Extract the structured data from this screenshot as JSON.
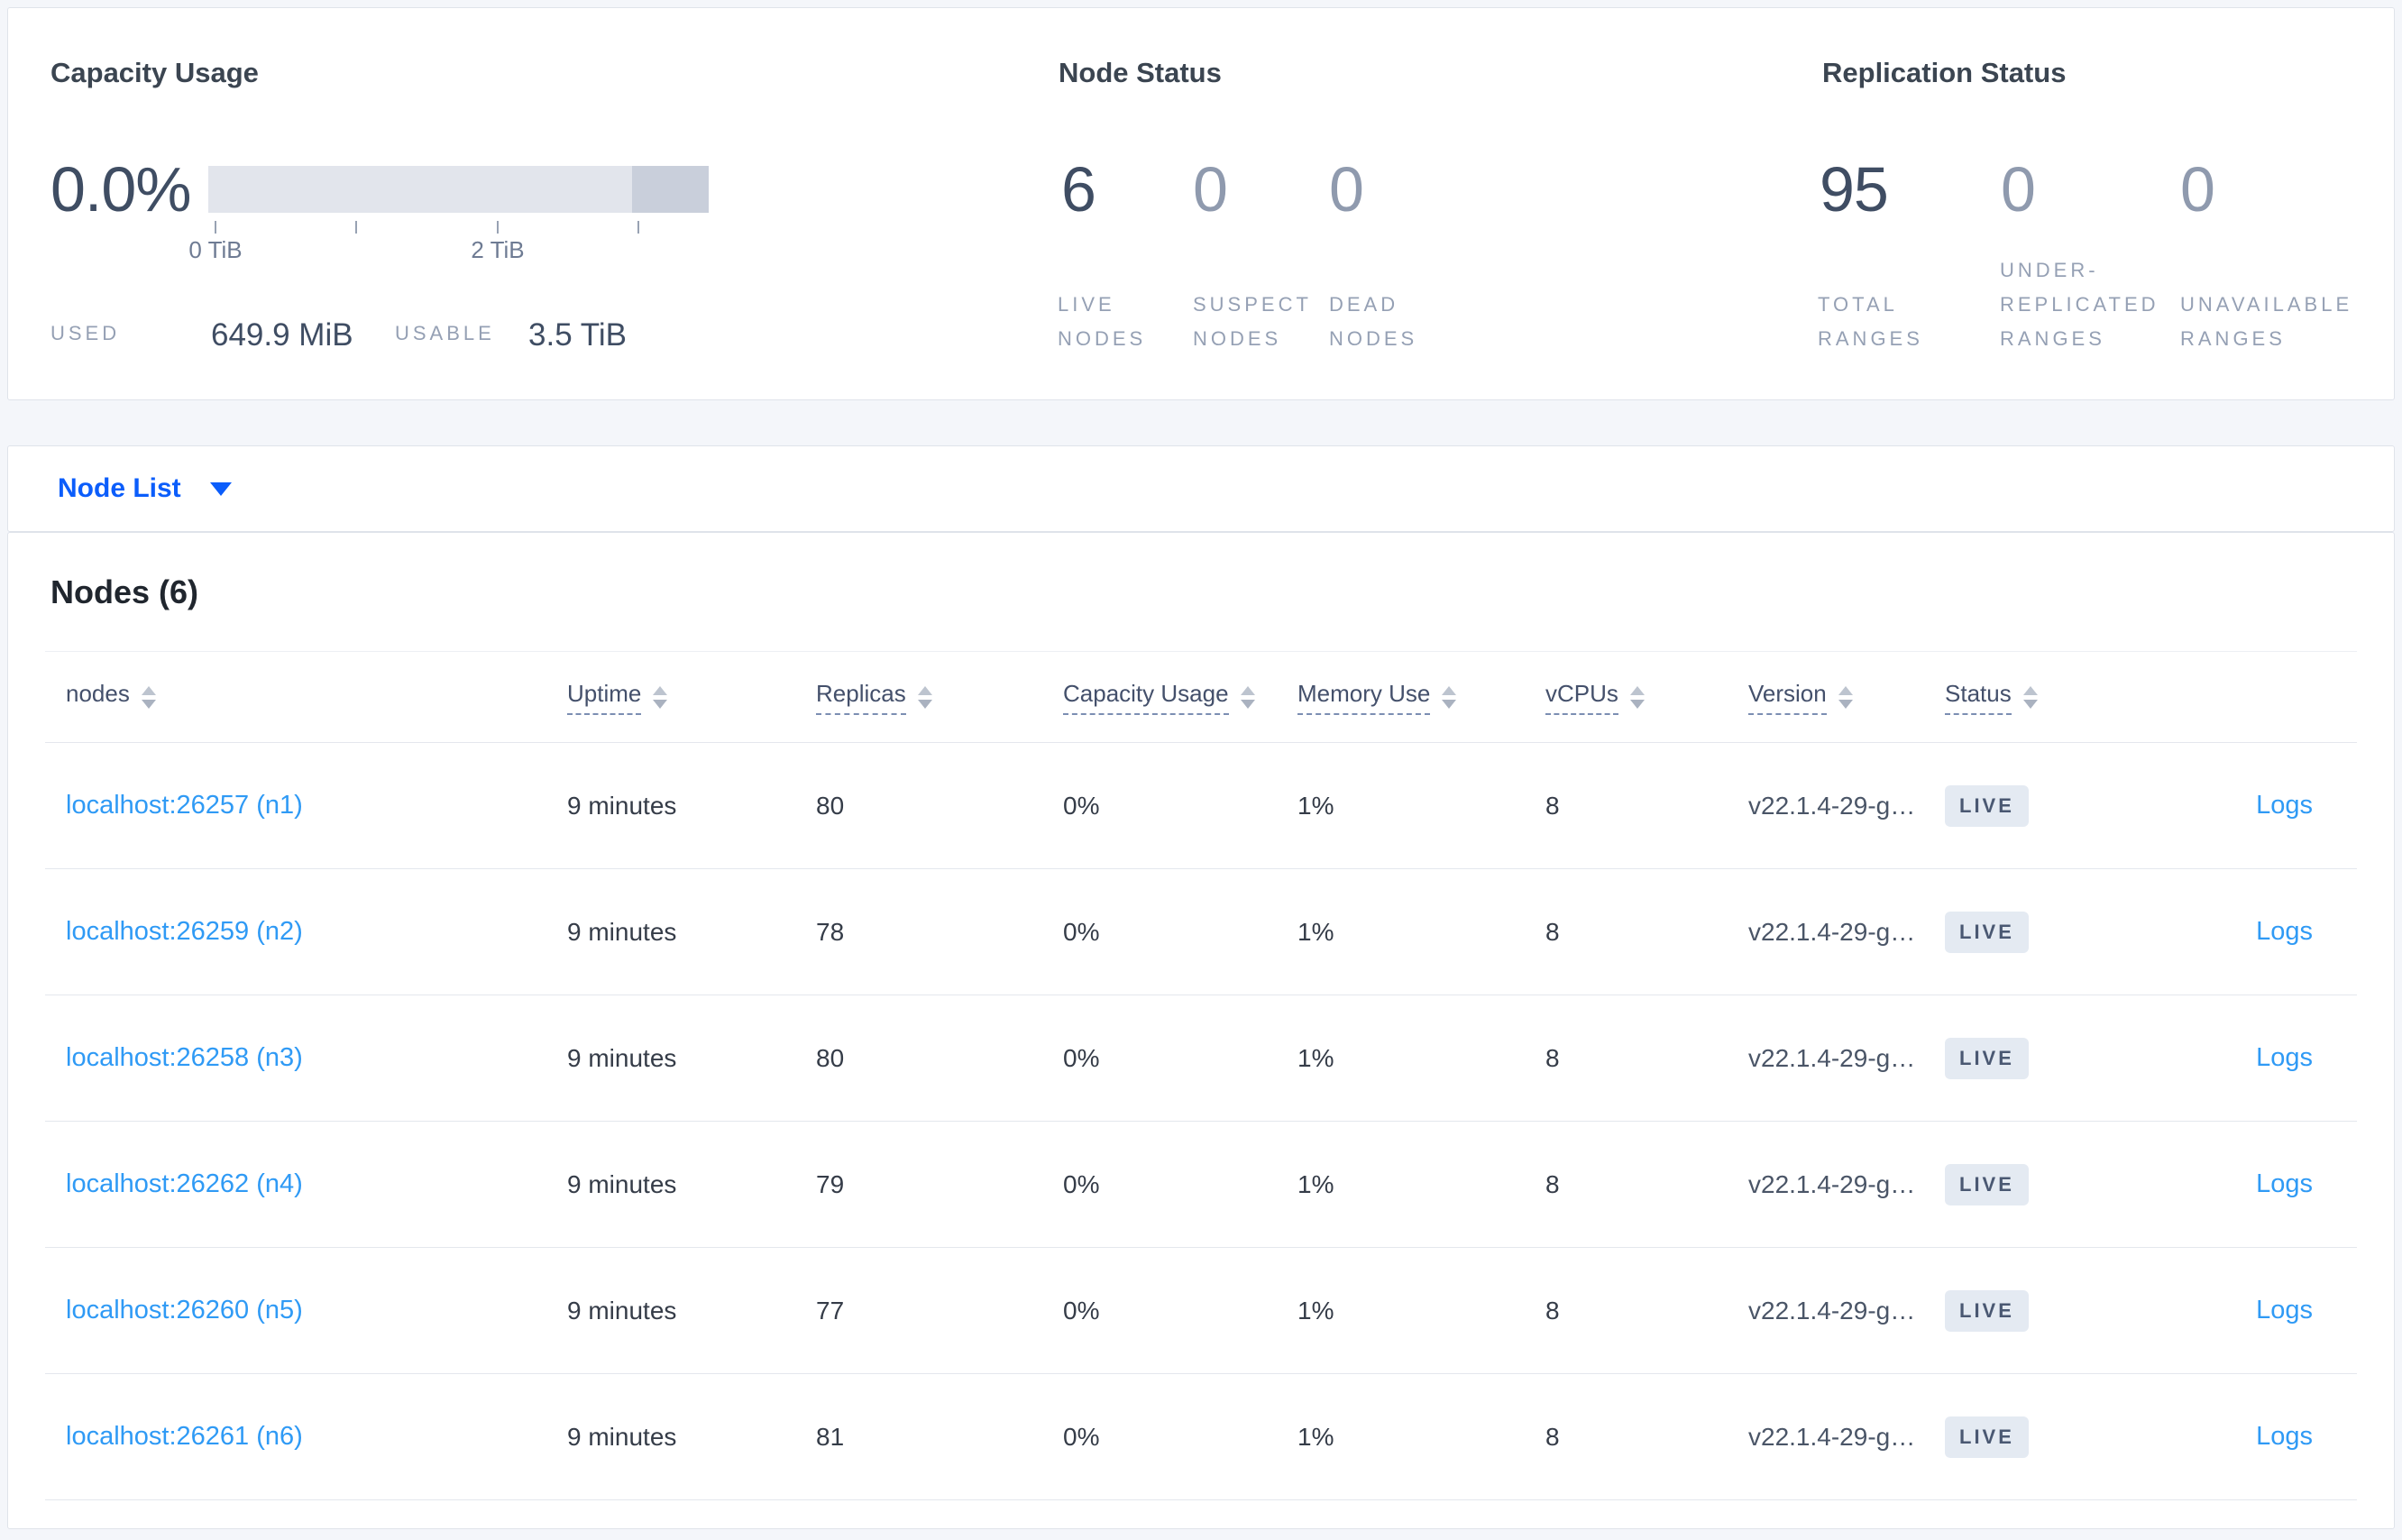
{
  "summary": {
    "capacity": {
      "title": "Capacity Usage",
      "percent": "0.0%",
      "tick_labels": [
        "0 TiB",
        "2 TiB"
      ],
      "used_label": "USED",
      "used_value": "649.9 MiB",
      "usable_label": "USABLE",
      "usable_value": "3.5 TiB",
      "bar_track_color": "#e2e5ec",
      "bar_tail_color": "#c9cfdb"
    },
    "node_status": {
      "title": "Node Status",
      "metrics": [
        {
          "value": "6",
          "label": "LIVE NODES",
          "emphasis": true
        },
        {
          "value": "0",
          "label": "SUSPECT NODES",
          "emphasis": false
        },
        {
          "value": "0",
          "label": "DEAD NODES",
          "emphasis": false
        }
      ]
    },
    "replication": {
      "title": "Replication Status",
      "metrics": [
        {
          "value": "95",
          "label": "TOTAL RANGES",
          "emphasis": true
        },
        {
          "value": "0",
          "label": "UNDER-REPLICATED RANGES",
          "emphasis": false
        },
        {
          "value": "0",
          "label": "UNAVAILABLE RANGES",
          "emphasis": false
        }
      ]
    }
  },
  "view_selector": {
    "label": "Node List"
  },
  "nodes_table": {
    "title": "Nodes (6)",
    "columns": [
      {
        "label": "nodes",
        "underlined": false
      },
      {
        "label": "Uptime",
        "underlined": true
      },
      {
        "label": "Replicas",
        "underlined": true
      },
      {
        "label": "Capacity Usage",
        "underlined": true
      },
      {
        "label": "Memory Use",
        "underlined": true
      },
      {
        "label": "vCPUs",
        "underlined": true
      },
      {
        "label": "Version",
        "underlined": true
      },
      {
        "label": "Status",
        "underlined": true
      }
    ],
    "rows": [
      {
        "node": "localhost:26257 (n1)",
        "uptime": "9 minutes",
        "replicas": "80",
        "capacity": "0%",
        "memory": "1%",
        "vcpus": "8",
        "version": "v22.1.4-29-g…",
        "status": "LIVE",
        "logs": "Logs"
      },
      {
        "node": "localhost:26259 (n2)",
        "uptime": "9 minutes",
        "replicas": "78",
        "capacity": "0%",
        "memory": "1%",
        "vcpus": "8",
        "version": "v22.1.4-29-g…",
        "status": "LIVE",
        "logs": "Logs"
      },
      {
        "node": "localhost:26258 (n3)",
        "uptime": "9 minutes",
        "replicas": "80",
        "capacity": "0%",
        "memory": "1%",
        "vcpus": "8",
        "version": "v22.1.4-29-g…",
        "status": "LIVE",
        "logs": "Logs"
      },
      {
        "node": "localhost:26262 (n4)",
        "uptime": "9 minutes",
        "replicas": "79",
        "capacity": "0%",
        "memory": "1%",
        "vcpus": "8",
        "version": "v22.1.4-29-g…",
        "status": "LIVE",
        "logs": "Logs"
      },
      {
        "node": "localhost:26260 (n5)",
        "uptime": "9 minutes",
        "replicas": "77",
        "capacity": "0%",
        "memory": "1%",
        "vcpus": "8",
        "version": "v22.1.4-29-g…",
        "status": "LIVE",
        "logs": "Logs"
      },
      {
        "node": "localhost:26261 (n6)",
        "uptime": "9 minutes",
        "replicas": "81",
        "capacity": "0%",
        "memory": "1%",
        "vcpus": "8",
        "version": "v22.1.4-29-g…",
        "status": "LIVE",
        "logs": "Logs"
      }
    ]
  },
  "colors": {
    "page_background": "#f4f6fa",
    "card_border": "#dfe3ea",
    "primary_blue": "#0b5dfb",
    "link_blue": "#2f9af5",
    "emphasis_text": "#3f4d63",
    "muted_value": "#8f9aae",
    "caps_label": "#95a0b4",
    "badge_background": "#e4eaf2",
    "badge_text": "#4a5872"
  }
}
